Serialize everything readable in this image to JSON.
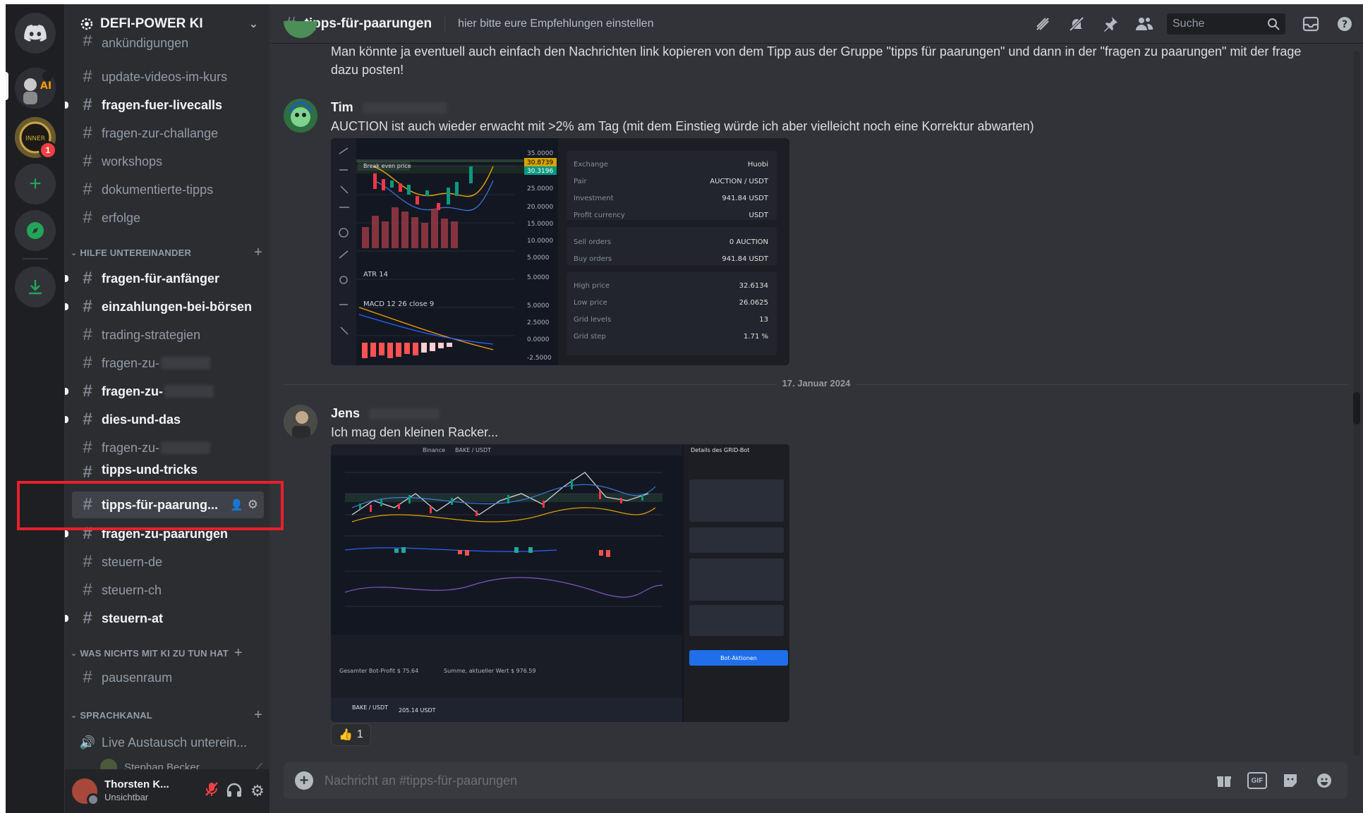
{
  "server": {
    "name": "DEFI-POWER KI",
    "dropdown_icon": "chevron-down-icon"
  },
  "guild_badge": "1",
  "channels_top": [
    {
      "label": "ankündigungen"
    },
    {
      "label": "update-videos-im-kurs"
    },
    {
      "label": "fragen-fuer-livecalls"
    },
    {
      "label": "fragen-zur-challange"
    },
    {
      "label": "workshops"
    },
    {
      "label": "dokumentierte-tipps"
    },
    {
      "label": "erfolge"
    }
  ],
  "category_help": "HILFE UNTEREINANDER",
  "channels_help": [
    {
      "label": "fragen-für-anfänger"
    },
    {
      "label": "einzahlungen-bei-börsen"
    },
    {
      "label": "trading-strategien"
    },
    {
      "label": "fragen-zu-"
    },
    {
      "label": "fragen-zu-"
    },
    {
      "label": "dies-und-das"
    },
    {
      "label": "fragen-zu-"
    },
    {
      "label": "tipps-und-tricks"
    },
    {
      "label": "tipps-für-paarung..."
    },
    {
      "label": "fragen-zu-paarungen"
    },
    {
      "label": "steuern-de"
    },
    {
      "label": "steuern-ch"
    },
    {
      "label": "steuern-at"
    }
  ],
  "category_offtopic": "WAS NICHTS MIT KI ZU TUN HAT",
  "channels_offtopic": [
    {
      "label": "pausenraum"
    }
  ],
  "category_voice": "SPRACHKANAL",
  "voice_channel": {
    "label": "Live Austausch unterein...",
    "member": "Stephan Becker"
  },
  "user_panel": {
    "name": "Thorsten K...",
    "status": "Unsichtbar"
  },
  "topbar": {
    "channel": "tipps-für-paarungen",
    "topic": "hier bitte eure Empfehlungen einstellen",
    "search_placeholder": "Suche"
  },
  "messages": {
    "first_text": "Man könnte ja eventuell auch einfach den Nachrichten link kopieren von dem Tipp aus der Gruppe \"tipps für paarungen\" und dann in der \"fragen zu paarungen\"  mit der frage dazu posten!",
    "tim_author": "Tim",
    "tim_text": "AUCTION ist auch wieder erwacht mit >2% am Tag (mit dem Einstieg würde ich aber vielleicht noch eine Korrektur abwarten)",
    "date_divider": "17. Januar 2024",
    "jens_author": "Jens",
    "jens_text": "Ich mag den kleinen Racker...",
    "reaction_emoji": "👍",
    "reaction_count": "1"
  },
  "attachment1": {
    "break_even": "Break even price",
    "atr": "ATR 14",
    "macd": "MACD 12 26 close 9",
    "prices": [
      "35.0000",
      "30.8739",
      "30.3196",
      "25.0000",
      "20.0000",
      "15.0000",
      "10.0000",
      "5.0000",
      "5.0000",
      "5.0000",
      "2.5000",
      "0.0000",
      "-2.5000"
    ],
    "details": [
      {
        "k": "Exchange",
        "v": "Huobi"
      },
      {
        "k": "Pair",
        "v": "AUCTION / USDT"
      },
      {
        "k": "Investment",
        "v": "941.84 USDT"
      },
      {
        "k": "Profit currency",
        "v": "USDT"
      },
      {
        "k": "Sell orders",
        "v": "0 AUCTION"
      },
      {
        "k": "Buy orders",
        "v": "941.84 USDT"
      },
      {
        "k": "High price",
        "v": "32.6134"
      },
      {
        "k": "Low price",
        "v": "26.0625"
      },
      {
        "k": "Grid levels",
        "v": "13"
      },
      {
        "k": "Grid step",
        "v": "1.71 %"
      }
    ]
  },
  "attachment2": {
    "panel_title": "Details des GRID-Bot",
    "pair_label": "BAKE / USDT",
    "exchange": "Binance",
    "button": "Bot-Aktionen",
    "profit": "Gesamter Bot-Profit $ 75.64",
    "total": "Summe, aktueller Wert $ 976.59",
    "row_pair": "BAKE / USDT",
    "row_value": "205.14 USDT"
  },
  "chat_input": {
    "placeholder": "Nachricht an #tipps-für-paarungen"
  },
  "colors": {
    "accent": "#5865f2",
    "highlight": "#e8202a",
    "green": "#23a559"
  }
}
